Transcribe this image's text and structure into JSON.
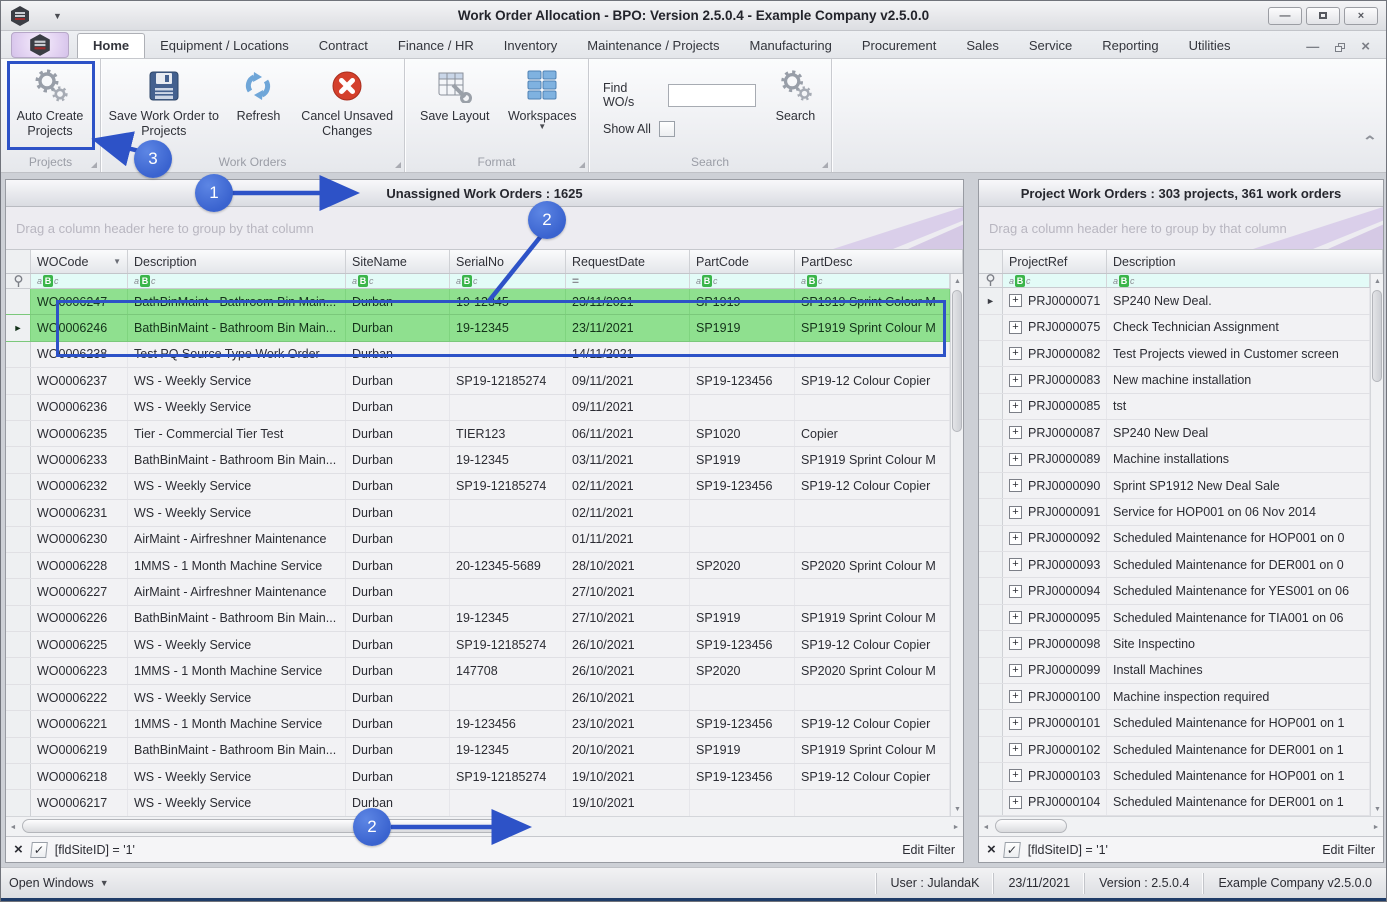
{
  "titlebar": {
    "title": "Work Order Allocation - BPO: Version 2.5.0.4 - Example Company v2.5.0.0",
    "minimize_glyph": "—",
    "close_glyph": "×",
    "qat_caret": "▼"
  },
  "tabs": [
    "Home",
    "Equipment / Locations",
    "Contract",
    "Finance / HR",
    "Inventory",
    "Maintenance / Projects",
    "Manufacturing",
    "Procurement",
    "Sales",
    "Service",
    "Reporting",
    "Utilities"
  ],
  "active_tab": "Home",
  "ribbon": {
    "projects_caption": "Projects",
    "workorders_caption": "Work Orders",
    "format_caption": "Format",
    "search_caption": "Search",
    "auto_create": "Auto Create Projects",
    "save_wo": "Save Work Order to Projects",
    "refresh": "Refresh",
    "cancel_unsaved": "Cancel Unsaved Changes",
    "save_layout": "Save Layout",
    "workspaces": "Workspaces",
    "find_label": "Find WO/s",
    "find_value": "",
    "show_all_label": "Show All",
    "show_all_checked": false,
    "search_btn": "Search"
  },
  "left_panel": {
    "title": "Unassigned Work Orders : 1625",
    "groupby_hint": "Drag a column header here to group by that column",
    "columns": [
      "WOCode",
      "Description",
      "SiteName",
      "SerialNo",
      "RequestDate",
      "PartCode",
      "PartDesc"
    ],
    "filter_types": [
      "abc",
      "abc",
      "abc",
      "abc",
      "eq",
      "abc",
      "abc"
    ],
    "selected_rows": [
      0,
      1
    ],
    "indicator_row": 1,
    "rows": [
      [
        "WO0006247",
        "BathBinMaint - Bathroom Bin Main...",
        "Durban",
        "19-12345",
        "23/11/2021",
        "SP1919",
        "SP1919 Sprint Colour M"
      ],
      [
        "WO0006246",
        "BathBinMaint - Bathroom Bin Main...",
        "Durban",
        "19-12345",
        "23/11/2021",
        "SP1919",
        "SP1919 Sprint Colour M"
      ],
      [
        "WO0006238",
        "Test PQ Source Type Work Order",
        "Durban",
        "",
        "14/11/2021",
        "",
        ""
      ],
      [
        "WO0006237",
        "WS - Weekly Service",
        "Durban",
        "SP19-12185274",
        "09/11/2021",
        "SP19-123456",
        "SP19-12 Colour Copier"
      ],
      [
        "WO0006236",
        "WS - Weekly Service",
        "Durban",
        "",
        "09/11/2021",
        "",
        ""
      ],
      [
        "WO0006235",
        "Tier - Commercial Tier Test",
        "Durban",
        "TIER123",
        "06/11/2021",
        "SP1020",
        "Copier"
      ],
      [
        "WO0006233",
        "BathBinMaint - Bathroom Bin Main...",
        "Durban",
        "19-12345",
        "03/11/2021",
        "SP1919",
        "SP1919 Sprint Colour M"
      ],
      [
        "WO0006232",
        "WS - Weekly Service",
        "Durban",
        "SP19-12185274",
        "02/11/2021",
        "SP19-123456",
        "SP19-12 Colour Copier"
      ],
      [
        "WO0006231",
        "WS - Weekly Service",
        "Durban",
        "",
        "02/11/2021",
        "",
        ""
      ],
      [
        "WO0006230",
        "AirMaint - Airfreshner Maintenance",
        "Durban",
        "",
        "01/11/2021",
        "",
        ""
      ],
      [
        "WO0006228",
        "1MMS - 1 Month Machine Service",
        "Durban",
        "20-12345-5689",
        "28/10/2021",
        "SP2020",
        "SP2020 Sprint Colour M"
      ],
      [
        "WO0006227",
        "AirMaint - Airfreshner Maintenance",
        "Durban",
        "",
        "27/10/2021",
        "",
        ""
      ],
      [
        "WO0006226",
        "BathBinMaint - Bathroom Bin Main...",
        "Durban",
        "19-12345",
        "27/10/2021",
        "SP1919",
        "SP1919 Sprint Colour M"
      ],
      [
        "WO0006225",
        "WS - Weekly Service",
        "Durban",
        "SP19-12185274",
        "26/10/2021",
        "SP19-123456",
        "SP19-12 Colour Copier"
      ],
      [
        "WO0006223",
        "1MMS - 1 Month Machine Service",
        "Durban",
        "147708",
        "26/10/2021",
        "SP2020",
        "SP2020 Sprint Colour M"
      ],
      [
        "WO0006222",
        "WS - Weekly Service",
        "Durban",
        "",
        "26/10/2021",
        "",
        ""
      ],
      [
        "WO0006221",
        "1MMS - 1 Month Machine Service",
        "Durban",
        "19-123456",
        "23/10/2021",
        "SP19-123456",
        "SP19-12 Colour Copier"
      ],
      [
        "WO0006219",
        "BathBinMaint - Bathroom Bin Main...",
        "Durban",
        "19-12345",
        "20/10/2021",
        "SP1919",
        "SP1919 Sprint Colour M"
      ],
      [
        "WO0006218",
        "WS - Weekly Service",
        "Durban",
        "SP19-12185274",
        "19/10/2021",
        "SP19-123456",
        "SP19-12 Colour Copier"
      ],
      [
        "WO0006217",
        "WS - Weekly Service",
        "Durban",
        "",
        "19/10/2021",
        "",
        ""
      ]
    ],
    "filter_expression": "[fldSiteID] = '1'",
    "edit_filter_label": "Edit Filter"
  },
  "right_panel": {
    "title": "Project Work Orders : 303 projects, 361 work orders",
    "groupby_hint": "Drag a column header here to group by that column",
    "columns": [
      "ProjectRef",
      "Description"
    ],
    "filter_types": [
      "abc",
      "abc"
    ],
    "selected_rows": [],
    "indicator_row": 0,
    "rows": [
      [
        "PRJ0000071",
        "SP240 New Deal."
      ],
      [
        "PRJ0000075",
        "Check Technician Assignment"
      ],
      [
        "PRJ0000082",
        "Test Projects viewed in Customer screen"
      ],
      [
        "PRJ0000083",
        "New machine installation"
      ],
      [
        "PRJ0000085",
        "tst"
      ],
      [
        "PRJ0000087",
        "SP240 New Deal"
      ],
      [
        "PRJ0000089",
        "Machine installations"
      ],
      [
        "PRJ0000090",
        "Sprint SP1912 New Deal Sale"
      ],
      [
        "PRJ0000091",
        "Service for HOP001 on 06 Nov 2014"
      ],
      [
        "PRJ0000092",
        "Scheduled Maintenance for HOP001 on 0"
      ],
      [
        "PRJ0000093",
        "Scheduled Maintenance for DER001 on 0"
      ],
      [
        "PRJ0000094",
        "Scheduled Maintenance for YES001 on 06"
      ],
      [
        "PRJ0000095",
        "Scheduled Maintenance for TIA001 on 06"
      ],
      [
        "PRJ0000098",
        "Site Inspectino"
      ],
      [
        "PRJ0000099",
        "Install Machines"
      ],
      [
        "PRJ0000100",
        "Machine inspection required"
      ],
      [
        "PRJ0000101",
        "Scheduled Maintenance for HOP001 on 1"
      ],
      [
        "PRJ0000102",
        "Scheduled Maintenance for DER001 on 1"
      ],
      [
        "PRJ0000103",
        "Scheduled Maintenance for HOP001 on 1"
      ],
      [
        "PRJ0000104",
        "Scheduled Maintenance for DER001 on 1"
      ]
    ],
    "filter_expression": "[fldSiteID] = '1'",
    "edit_filter_label": "Edit Filter"
  },
  "statusbar": {
    "open_windows": "Open Windows",
    "user": "User : JulandaK",
    "date": "23/11/2021",
    "version": "Version : 2.5.0.4",
    "company": "Example Company v2.5.0.0"
  },
  "annotations": {
    "step1": "1",
    "step2a": "2",
    "step2b": "2",
    "step3": "3"
  },
  "colors": {
    "annotation_blue": "#2d52c7",
    "selected_row_green": "#8fe08f",
    "filter_row_aqua": "#e3fbf7"
  }
}
